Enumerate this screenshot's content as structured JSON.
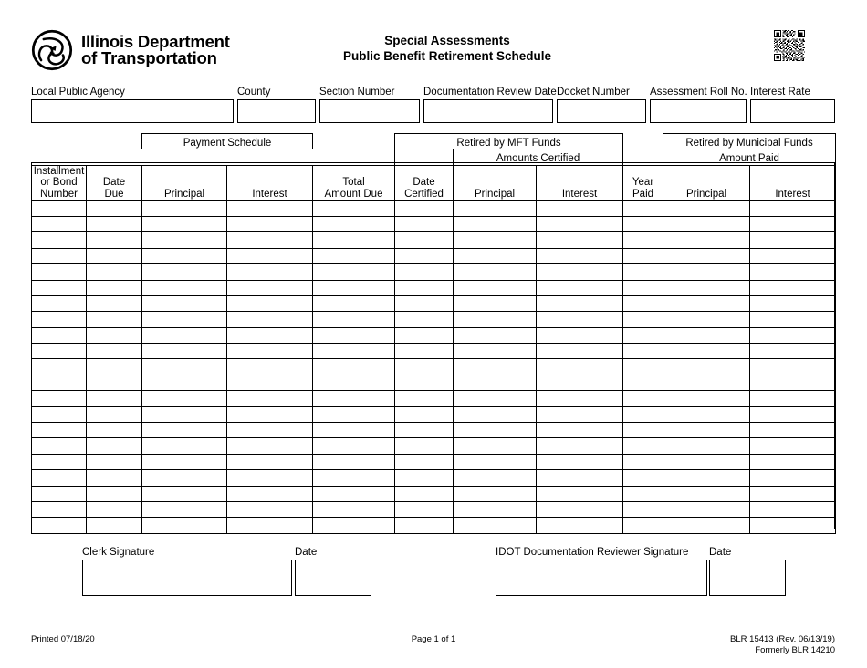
{
  "header": {
    "agency_line1": "Illinois Department",
    "agency_line2": "of Transportation",
    "logo_icon": "idot-triskelion-logo-icon",
    "title_line1": "Special Assessments",
    "title_line2": "Public Benefit Retirement Schedule",
    "qr_icon": "qr-code-icon"
  },
  "top_fields": [
    {
      "label": "Local Public Agency",
      "value": ""
    },
    {
      "label": "County",
      "value": ""
    },
    {
      "label": "Section Number",
      "value": ""
    },
    {
      "label": "Documentation Review Date",
      "value": ""
    },
    {
      "label": "Docket Number",
      "value": ""
    },
    {
      "label": "Assessment Roll No.",
      "value": ""
    },
    {
      "label": "Interest Rate",
      "value": ""
    }
  ],
  "table": {
    "group_headers": {
      "payment_schedule": "Payment Schedule",
      "retired_mft": "Retired by MFT Funds",
      "amounts_certified": "Amounts Certified",
      "retired_municipal": "Retired by Municipal Funds",
      "amount_paid": "Amount Paid"
    },
    "columns": [
      {
        "label": "Installment\nor Bond\nNumber",
        "line1": "Installment",
        "line2": "or Bond",
        "line3": "Number"
      },
      {
        "label": "Date Due",
        "line1": "",
        "line2": "Date",
        "line3": "Due"
      },
      {
        "label": "Principal",
        "line1": "",
        "line2": "",
        "line3": "Principal"
      },
      {
        "label": "Interest",
        "line1": "",
        "line2": "",
        "line3": "Interest"
      },
      {
        "label": "Total Amount Due",
        "line1": "",
        "line2": "Total",
        "line3": "Amount Due"
      },
      {
        "label": "Date Certified",
        "line1": "",
        "line2": "Date",
        "line3": "Certified"
      },
      {
        "label": "Principal",
        "line1": "",
        "line2": "",
        "line3": "Principal"
      },
      {
        "label": "Interest",
        "line1": "",
        "line2": "",
        "line3": "Interest"
      },
      {
        "label": "Year Paid",
        "line1": "",
        "line2": "Year",
        "line3": "Paid"
      },
      {
        "label": "Principal",
        "line1": "",
        "line2": "",
        "line3": "Principal"
      },
      {
        "label": "Interest",
        "line1": "",
        "line2": "",
        "line3": "Interest"
      }
    ],
    "row_count": 21,
    "rows": [
      [
        "",
        "",
        "",
        "",
        "",
        "",
        "",
        "",
        "",
        "",
        ""
      ],
      [
        "",
        "",
        "",
        "",
        "",
        "",
        "",
        "",
        "",
        "",
        ""
      ],
      [
        "",
        "",
        "",
        "",
        "",
        "",
        "",
        "",
        "",
        "",
        ""
      ],
      [
        "",
        "",
        "",
        "",
        "",
        "",
        "",
        "",
        "",
        "",
        ""
      ],
      [
        "",
        "",
        "",
        "",
        "",
        "",
        "",
        "",
        "",
        "",
        ""
      ],
      [
        "",
        "",
        "",
        "",
        "",
        "",
        "",
        "",
        "",
        "",
        ""
      ],
      [
        "",
        "",
        "",
        "",
        "",
        "",
        "",
        "",
        "",
        "",
        ""
      ],
      [
        "",
        "",
        "",
        "",
        "",
        "",
        "",
        "",
        "",
        "",
        ""
      ],
      [
        "",
        "",
        "",
        "",
        "",
        "",
        "",
        "",
        "",
        "",
        ""
      ],
      [
        "",
        "",
        "",
        "",
        "",
        "",
        "",
        "",
        "",
        "",
        ""
      ],
      [
        "",
        "",
        "",
        "",
        "",
        "",
        "",
        "",
        "",
        "",
        ""
      ],
      [
        "",
        "",
        "",
        "",
        "",
        "",
        "",
        "",
        "",
        "",
        ""
      ],
      [
        "",
        "",
        "",
        "",
        "",
        "",
        "",
        "",
        "",
        "",
        ""
      ],
      [
        "",
        "",
        "",
        "",
        "",
        "",
        "",
        "",
        "",
        "",
        ""
      ],
      [
        "",
        "",
        "",
        "",
        "",
        "",
        "",
        "",
        "",
        "",
        ""
      ],
      [
        "",
        "",
        "",
        "",
        "",
        "",
        "",
        "",
        "",
        "",
        ""
      ],
      [
        "",
        "",
        "",
        "",
        "",
        "",
        "",
        "",
        "",
        "",
        ""
      ],
      [
        "",
        "",
        "",
        "",
        "",
        "",
        "",
        "",
        "",
        "",
        ""
      ],
      [
        "",
        "",
        "",
        "",
        "",
        "",
        "",
        "",
        "",
        "",
        ""
      ],
      [
        "",
        "",
        "",
        "",
        "",
        "",
        "",
        "",
        "",
        "",
        ""
      ],
      [
        "",
        "",
        "",
        "",
        "",
        "",
        "",
        "",
        "",
        "",
        ""
      ]
    ]
  },
  "signatures": [
    {
      "label": "Clerk Signature",
      "value": ""
    },
    {
      "label": "Date",
      "value": ""
    },
    {
      "label": "IDOT Documentation Reviewer Signature",
      "value": ""
    },
    {
      "label": "Date",
      "value": ""
    }
  ],
  "footer": {
    "printed": "Printed 07/18/20",
    "page": "Page 1 of 1",
    "form_id": "BLR 15413 (Rev. 06/13/19)",
    "formerly": "Formerly BLR 14210"
  }
}
